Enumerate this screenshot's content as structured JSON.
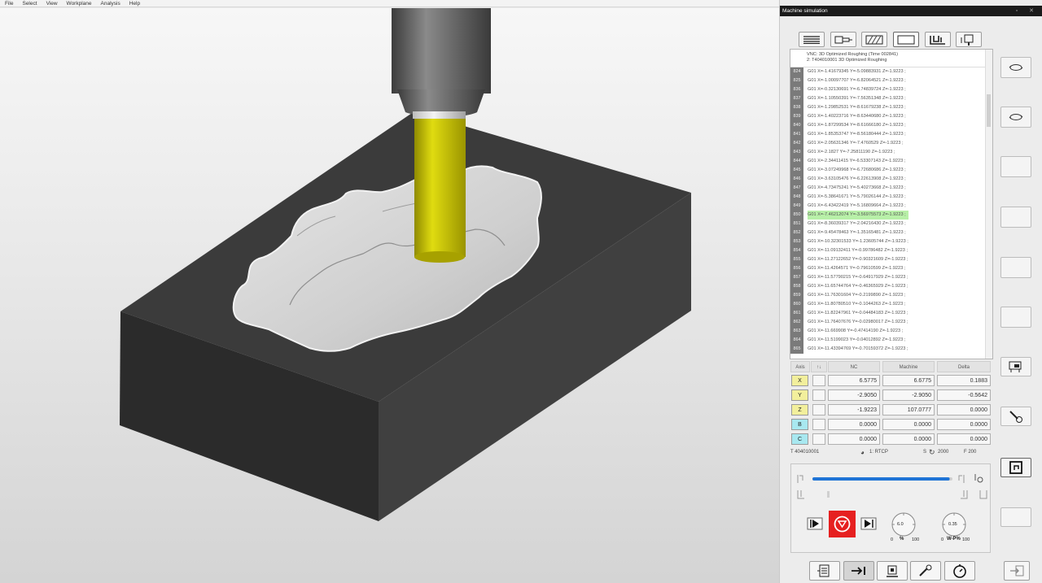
{
  "menu": [
    "File",
    "Select",
    "View",
    "Workplane",
    "Analysis",
    "Help"
  ],
  "panel": {
    "title": "Machine simulation",
    "toolbar_icons": [
      "list-icon",
      "spindle-icon",
      "hatch-icon",
      "blank-icon",
      "machine-icon",
      "tool-holder-icon"
    ]
  },
  "nc": {
    "header_line1": "VNC: 3D Optimized Roughing (Time 002841)",
    "header_line2": "2: T404010001 3D Optimized Roughing",
    "rows": [
      {
        "ln": "824",
        "text": "G01 X=-1.41679345 Y=-5.09883931 Z=-1.9223 ;"
      },
      {
        "ln": "825",
        "text": "G01 X=-1.00097707 Y=-6.82064521 Z=-1.9223 ;"
      },
      {
        "ln": "836",
        "text": "G01 X=-0.32130691 Y=-6.74839724 Z=-1.9223 ;"
      },
      {
        "ln": "837",
        "text": "G01 X=-1.10550391 Y=-7.56351348 Z=-1.9223 ;"
      },
      {
        "ln": "838",
        "text": "G01 X=-1.29852531 Y=-8.61679238 Z=-1.9223 ;"
      },
      {
        "ln": "839",
        "text": "G01 X=-1.40223716 Y=-8.63440680 Z=-1.9223 ;"
      },
      {
        "ln": "840",
        "text": "G01 X=-1.87299534 Y=-8.61666180 Z=-1.9223 ;"
      },
      {
        "ln": "841",
        "text": "G01 X=-1.85353747 Y=-8.56180444 Z=-1.9223 ;"
      },
      {
        "ln": "842",
        "text": "G01 X=-2.05631346 Y=-7.4760529 Z=-1.9223 ;"
      },
      {
        "ln": "843",
        "text": "G01 X=-2.1827 Y=-7.25811190 Z=-1.9223 ;"
      },
      {
        "ln": "844",
        "text": "G01 X=-2.34411415 Y=-6.53307143 Z=-1.9223 ;"
      },
      {
        "ln": "845",
        "text": "G01 X=-3.07249968 Y=-6.72680686 Z=-1.9223 ;"
      },
      {
        "ln": "846",
        "text": "G01 X=-3.63105476 Y=-6.22613908 Z=-1.9223 ;"
      },
      {
        "ln": "847",
        "text": "G01 X=-4.73475241 Y=-5.40273668 Z=-1.9223 ;"
      },
      {
        "ln": "848",
        "text": "G01 X=-5.38641671 Y=-5.79026144 Z=-1.9223 ;"
      },
      {
        "ln": "849",
        "text": "G01 X=-6.43422419 Y=-5.16809664 Z=-1.9223 ;"
      },
      {
        "ln": "850",
        "text": "G01 X=-7.46212074 Y=-3.56975573 Z=-1.9223 ;"
      },
      {
        "ln": "851",
        "text": "G01 X=-8.36039317 Y=-2.04216430 Z=-1.9223 ;"
      },
      {
        "ln": "852",
        "text": "G01 X=-9.45478463 Y=-1.35165481 Z=-1.9223 ;"
      },
      {
        "ln": "853",
        "text": "G01 X=-10.32301533 Y=-1.23605744 Z=-1.9223 ;"
      },
      {
        "ln": "854",
        "text": "G01 X=-11.09132411 Y=-0.99786482 Z=-1.9223 ;"
      },
      {
        "ln": "855",
        "text": "G01 X=-11.27122652 Y=-0.90321609 Z=-1.9223 ;"
      },
      {
        "ln": "856",
        "text": "G01 X=-11.4264571 Y=-0.79610599 Z=-1.9223 ;"
      },
      {
        "ln": "857",
        "text": "G01 X=-11.57790215 Y=-0.64917929 Z=-1.9223 ;"
      },
      {
        "ln": "858",
        "text": "G01 X=-11.65744764 Y=-0.46365929 Z=-1.9223 ;"
      },
      {
        "ln": "859",
        "text": "G01 X=-11.76301604 Y=-0.2199890 Z=-1.9223 ;"
      },
      {
        "ln": "860",
        "text": "G01 X=-11.80780510 Y=-0.1044263 Z=-1.9223 ;"
      },
      {
        "ln": "861",
        "text": "G01 X=-11.82247961 Y=-0.04484183 Z=-1.9223 ;"
      },
      {
        "ln": "862",
        "text": "G01 X=-11.76407676 Y=-0.02980017 Z=-1.9223 ;"
      },
      {
        "ln": "863",
        "text": "G01 X=-11.669908 Y=-0.47414190 Z=-1.9223 ;"
      },
      {
        "ln": "864",
        "text": "G01 X=-11.5199023 Y=-0.04012892 Z=-1.9223 ;"
      },
      {
        "ln": "865",
        "text": "G01 X=-11.43394769 Y=-0.70159372 Z=-1.9223 ;"
      }
    ],
    "highlight_index": 16
  },
  "axes": {
    "headers": {
      "axis": "Axis",
      "nc": "NC",
      "machine": "Machine",
      "delta": "Delta"
    },
    "rows": [
      {
        "label": "X",
        "color": "#f2ef9c",
        "nc": "6.5775",
        "machine": "6.6775",
        "delta": "0.1883"
      },
      {
        "label": "Y",
        "color": "#f2ef9c",
        "nc": "-2.9050",
        "machine": "-2.9050",
        "delta": "-0.5642"
      },
      {
        "label": "Z",
        "color": "#f2ef9c",
        "nc": "-1.9223",
        "machine": "107.0777",
        "delta": "0.0000"
      },
      {
        "label": "B",
        "color": "#a8e8f0",
        "nc": "0.0000",
        "machine": "0.0000",
        "delta": "0.0000"
      },
      {
        "label": "C",
        "color": "#a8e8f0",
        "nc": "0.0000",
        "machine": "0.0000",
        "delta": "0.0000"
      }
    ]
  },
  "status": {
    "tool": "T 404010001",
    "mode": "1:  RTCP",
    "spindle": "S",
    "spindle_val": "2000",
    "feed": "F 200"
  },
  "sim": {
    "progress": 0.98,
    "speed_gauge": "6.0",
    "speed_min": "0",
    "speed_pct": "%",
    "speed_max": "100",
    "wp_gauge": "0.35",
    "wp_min": "0",
    "wp_label": "W-P%",
    "wp_max": "100"
  },
  "colors": {
    "stop": "#e62020",
    "highlight": "#b8f0a8",
    "progress": "#1f74d6",
    "tool": "#c9c400"
  }
}
